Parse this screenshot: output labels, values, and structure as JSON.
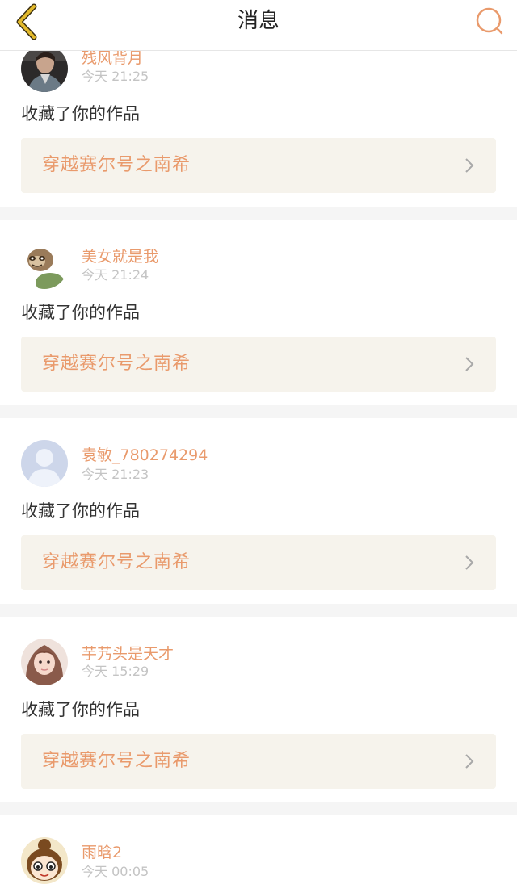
{
  "header": {
    "title": "消息",
    "back_icon": "chevron-left-icon",
    "search_icon": "search-icon",
    "accent_color": "#e99a6c",
    "back_color": "#e2b92b"
  },
  "messages": [
    {
      "username": "残风背月",
      "time": "今天 21:25",
      "action": "收藏了你的作品",
      "work_title": "穿越赛尔号之南希",
      "avatar": "man-photo-avatar"
    },
    {
      "username": "美女就是我",
      "time": "今天 21:24",
      "action": "收藏了你的作品",
      "work_title": "穿越赛尔号之南希",
      "avatar": "sloth-avatar"
    },
    {
      "username": "袁敏_780274294",
      "time": "今天 21:23",
      "action": "收藏了你的作品",
      "work_title": "穿越赛尔号之南希",
      "avatar": "default-person-avatar"
    },
    {
      "username": "芋艿头是天才",
      "time": "今天 15:29",
      "action": "收藏了你的作品",
      "work_title": "穿越赛尔号之南希",
      "avatar": "girl-photo-avatar"
    },
    {
      "username": "雨晗2",
      "time": "今天 00:05",
      "action": "",
      "work_title": "",
      "avatar": "cartoon-girl-avatar"
    }
  ]
}
